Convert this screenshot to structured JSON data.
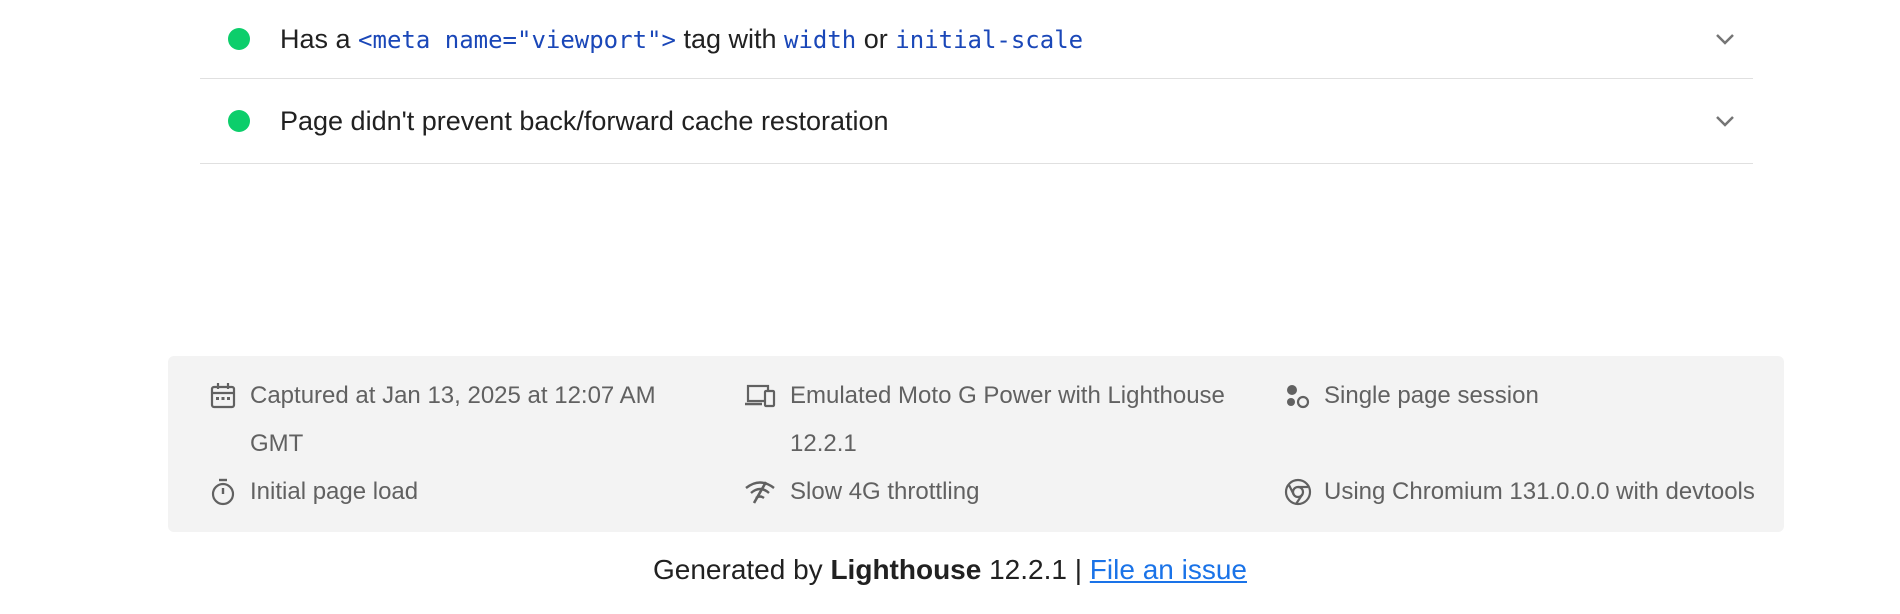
{
  "audits": [
    {
      "prefix": "Has a ",
      "code1": "<meta name=\"viewport\">",
      "mid": " tag with ",
      "code2": "width",
      "or": " or ",
      "code3": "initial-scale",
      "status": "pass"
    },
    {
      "title": "Page didn't prevent back/forward cache restoration",
      "status": "pass"
    }
  ],
  "footer": {
    "captured": "Captured at Jan 13, 2025 at 12:07 AM GMT",
    "emulated": "Emulated Moto G Power with Lighthouse 12.2.1",
    "session": "Single page session",
    "initial": "Initial page load",
    "throttling": "Slow 4G throttling",
    "chromium": "Using Chromium 131.0.0.0 with devtools"
  },
  "generated": {
    "prefix": "Generated by ",
    "brand": "Lighthouse",
    "version": " 12.2.1 | ",
    "link": "File an issue"
  },
  "colors": {
    "pass": "#0cce6b",
    "code": "#1a47b8",
    "link": "#1a73e8",
    "panel": "#f3f3f3"
  },
  "icons": [
    "chevron-down-icon",
    "calendar-icon",
    "devices-icon",
    "session-icon",
    "stopwatch-icon",
    "network-icon",
    "chrome-icon"
  ]
}
